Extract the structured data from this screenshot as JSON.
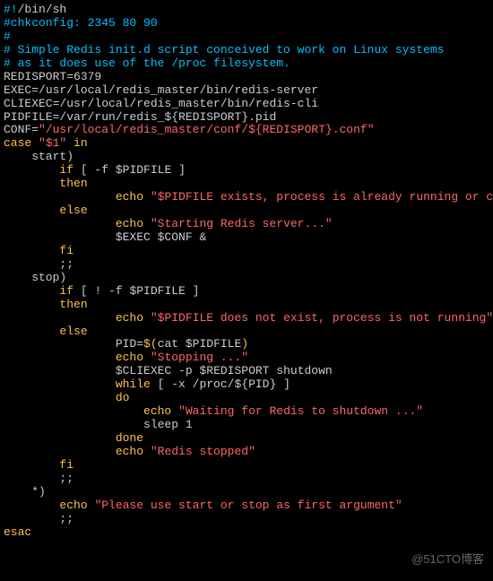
{
  "watermark": "@51CTO博客",
  "code": {
    "l1": {
      "c": "#!",
      "n": "/bin/sh"
    },
    "l2": "#chkconfig: 2345 80 90",
    "l3": "#",
    "l4": "# Simple Redis init.d script conceived to work on Linux systems",
    "l5": "# as it does use of the /proc filesystem.",
    "l6": "",
    "l7": {
      "a": "REDISPORT",
      "b": "=6379"
    },
    "l8": {
      "a": "EXEC",
      "b": "=/usr/local/redis_master/bin/redis-server"
    },
    "l9": {
      "a": "CLIEXEC",
      "b": "=/usr/local/redis_master/bin/redis-cli"
    },
    "l10": "",
    "l11": {
      "a": "PIDFILE",
      "b": "=/var/run/redis_",
      "c": "${REDISPORT}",
      "d": ".pid"
    },
    "l12": {
      "a": "CONF",
      "b": "=",
      "c": "\"/usr/local/redis_master/conf/",
      "d": "${REDISPORT}",
      "e": ".conf\""
    },
    "l13": "",
    "l14": {
      "a": "case",
      "b": " \"$1\" ",
      "c": "in"
    },
    "l15": "    start)",
    "l16": {
      "a": "        ",
      "b": "if",
      "c": " [ -f ",
      "d": "$PIDFILE",
      "e": " ]"
    },
    "l17": {
      "a": "        ",
      "b": "then"
    },
    "l18": {
      "a": "                ",
      "b": "echo",
      "c": " \"",
      "d": "$PIDFILE",
      "e": " exists, process is already running or crashed\""
    },
    "l19": {
      "a": "        ",
      "b": "else"
    },
    "l20": {
      "a": "                ",
      "b": "echo",
      "c": " \"Starting Redis server...\""
    },
    "l21": {
      "a": "                ",
      "b": "$EXEC $CONF",
      "c": " &"
    },
    "l22": {
      "a": "        ",
      "b": "fi"
    },
    "l23": "        ;;",
    "l24": "    stop)",
    "l25": {
      "a": "        ",
      "b": "if",
      "c": " [ ! -f ",
      "d": "$PIDFILE",
      "e": " ]"
    },
    "l26": {
      "a": "        ",
      "b": "then"
    },
    "l27": {
      "a": "                ",
      "b": "echo",
      "c": " \"",
      "d": "$PIDFILE",
      "e": " does not exist, process is not running\""
    },
    "l28": {
      "a": "        ",
      "b": "else"
    },
    "l29": {
      "a": "                ",
      "b": "PID",
      "c": "=",
      "d": "$(",
      "e": "cat ",
      "f": "$PIDFILE",
      "g": ")"
    },
    "l30": {
      "a": "                ",
      "b": "echo",
      "c": " \"Stopping ...\""
    },
    "l31": {
      "a": "                ",
      "b": "$CLIEXEC",
      "c": " -p ",
      "d": "$REDISPORT",
      "e": " shutdown"
    },
    "l32": {
      "a": "                ",
      "b": "while",
      "c": " [ -x /proc/",
      "d": "${PID}",
      "e": " ]"
    },
    "l33": {
      "a": "                ",
      "b": "do"
    },
    "l34": {
      "a": "                    ",
      "b": "echo",
      "c": " \"Waiting for Redis to shutdown ...\""
    },
    "l35": "                    sleep 1",
    "l36": {
      "a": "                ",
      "b": "done"
    },
    "l37": {
      "a": "                ",
      "b": "echo",
      "c": " \"Redis stopped\""
    },
    "l38": {
      "a": "        ",
      "b": "fi"
    },
    "l39": "        ;;",
    "l40": "    *)",
    "l41": {
      "a": "        ",
      "b": "echo",
      "c": " \"Please use start or stop as first argument\""
    },
    "l42": "        ;;",
    "l43": "esac"
  }
}
